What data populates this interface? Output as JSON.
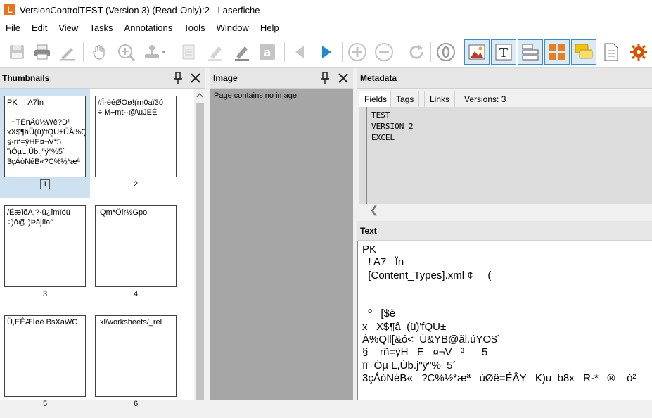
{
  "window": {
    "logo": "L",
    "title": "VersionControlTEST (Version 3) (Read-Only):2 - Laserfiche"
  },
  "menu": [
    "File",
    "Edit",
    "View",
    "Tasks",
    "Annotations",
    "Tools",
    "Window",
    "Help"
  ],
  "toolbar": {
    "icons": [
      "save-icon",
      "print-icon",
      "pen-icon",
      "hand-icon",
      "zoom-in-icon",
      "stamp-icon",
      "page-icon",
      "highlight-icon",
      "marker-icon",
      "text-annotation-icon",
      "back-icon",
      "forward-icon",
      "zoom-plus-icon",
      "zoom-minus-icon",
      "rotate-icon",
      "ocr-icon",
      "image-pane-icon",
      "text-pane-icon",
      "fields-pane-icon",
      "thumbnails-pane-icon",
      "annotations-pane-icon",
      "document-icon",
      "settings-icon"
    ]
  },
  "thumbnails": {
    "title": "Thumbnails",
    "pages": [
      {
        "number": "1",
        "text": "PK\u0003\u0004\u0014\u0000\u0006\u0000   ! A7Ïn\u0010  \u0010\u0010\n\n  ¬TÉnÂ0\u0010½Wê?D¹\nxX$¶âÜ(ü)'fQU±ÜÅ%Q\n§-rñ=ÿHE¤¬V*5 \u0010\nïï\u0010Óµ\u0010L,Úb.j\"ÿ\"%\u00105´\n3çÁòNéB«?C%½*æª"
      },
      {
        "number": "2",
        "text": "#\u0015Ï-\u0010ëéØOø!(rn0aï3ó\n÷\u0010\u0010\u0010IM÷mt-\u0010·@\\uJEÈ"
      },
      {
        "number": "3",
        "text": "/ËæìõA,?\u0010·û¿\u0010îmïöù\n÷)ô@,)Þãjíla^"
      },
      {
        "number": "4",
        "text": " Qm*Ôîr½Gpo\u0010"
      },
      {
        "number": "5",
        "text": "Ü,EÊÆIøè BsXàWC"
      },
      {
        "number": "6",
        "text": " xl/worksheets/_rel"
      }
    ]
  },
  "image": {
    "title": "Image",
    "message": "Page contains no image."
  },
  "metadata": {
    "title": "Metadata",
    "tabs": [
      "Fields",
      "Tags",
      "Links",
      "Versions: 3"
    ],
    "fields": [
      "TEST",
      "VERSION 2",
      "EXCEL"
    ]
  },
  "text": {
    "title": "Text",
    "content": "PK\u0010 \u0010 \u0010 \u0010\n  ! A7   Ïn\u0010   \u0010  \u0010    \u0010  \u0010\n  [Content_Types].xml ¢\u0010     (\n\n\n  º   [$è\nx   X$¶â\u0010  (ü)'fQU±\u0010\nÁ%Qll[&ó<\u0010  Ú&YB@ãl.úYO$`\n§    rñ=ÿH   E   ¤¬V   ³      5 \u0010\nïï\u0010  Óµ L,Úb.j\"ÿ\"%\u0010  5´\n3çÁòNéB«   ?C%½*æª   ùØë=ÉÂY   K)u\u0010  b8x   R-*   ®\u0010  \u0010  ò²"
  }
}
